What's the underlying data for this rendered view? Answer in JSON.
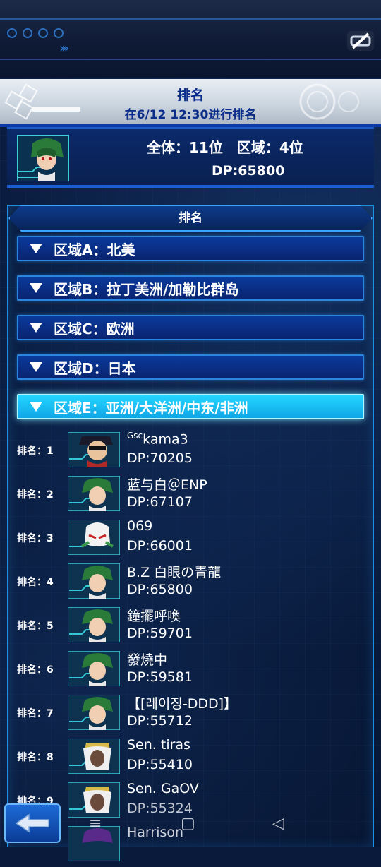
{
  "header": {
    "title": "排名",
    "subtitle": "在6/12 12:30进行排名"
  },
  "summary": {
    "overall_label": "全体：11位　区域：4位",
    "dp": "DP:65800"
  },
  "section": {
    "title": "排名"
  },
  "regions": [
    {
      "label": "区域A：北美",
      "active": false
    },
    {
      "label": "区域B：拉丁美洲/加勒比群岛",
      "active": false
    },
    {
      "label": "区域C：欧洲",
      "active": false
    },
    {
      "label": "区域D：日本",
      "active": false
    },
    {
      "label": "区域E：亚洲/大洋洲/中东/非洲",
      "active": true
    }
  ],
  "rankings": [
    {
      "rank": "排名：1",
      "name_prefix": "Gsc",
      "name": "kama3",
      "dp": "DP:70205"
    },
    {
      "rank": "排名：2",
      "name_prefix": "",
      "name": "蓝与白＠ENP",
      "dp": "DP:67107"
    },
    {
      "rank": "排名：3",
      "name_prefix": "",
      "name": "069",
      "dp": "DP:66001"
    },
    {
      "rank": "排名：4",
      "name_prefix": "",
      "name": "B.Z 白眼の青龍",
      "dp": "DP:65800"
    },
    {
      "rank": "排名：5",
      "name_prefix": "",
      "name": "鐘擺呼喚",
      "dp": "DP:59701"
    },
    {
      "rank": "排名：6",
      "name_prefix": "",
      "name": "發燒中",
      "dp": "DP:59581"
    },
    {
      "rank": "排名：7",
      "name_prefix": "",
      "name": "【[레이징-DDD]】",
      "dp": "DP:55712"
    },
    {
      "rank": "排名：8",
      "name_prefix": "",
      "name": "Sen. tiras",
      "dp": "DP:55410"
    },
    {
      "rank": "排名：9",
      "name_prefix": "",
      "name": "Sen. GaOV",
      "dp": "DP:55324"
    },
    {
      "rank": "",
      "name_prefix": "",
      "name": "Harrison",
      "dp": ""
    }
  ],
  "icons": {
    "back": "back-arrow-icon",
    "settings": "settings-slash-icon"
  },
  "colors": {
    "accent": "#1c8fe0",
    "active_region": "#23d6ff",
    "header_text": "#0b2d8a"
  }
}
